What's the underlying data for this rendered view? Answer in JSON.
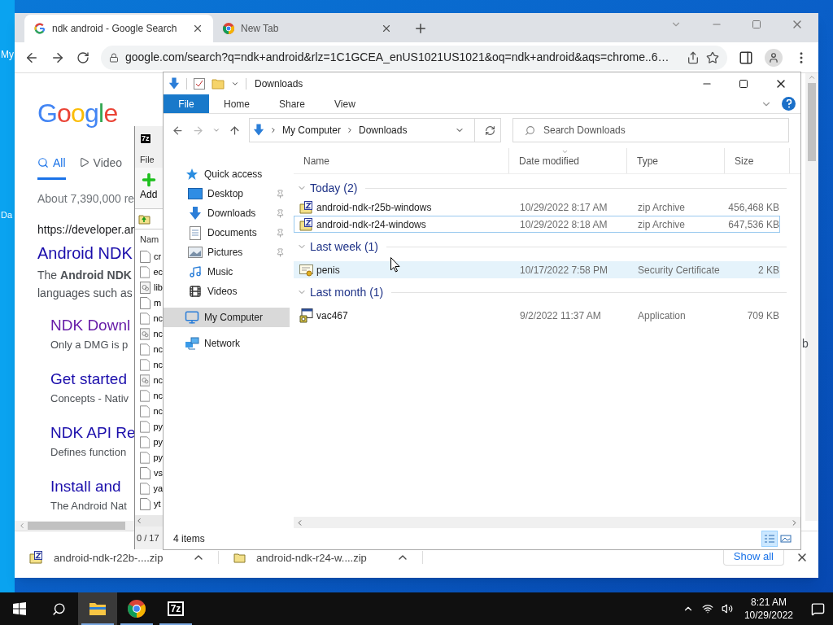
{
  "desktop": {
    "icons": [
      {
        "label": "My"
      },
      {
        "label": "Da"
      }
    ]
  },
  "chrome": {
    "tabs": [
      {
        "title": "ndk android - Google Search",
        "kind": "google",
        "selected": true
      },
      {
        "title": "New Tab",
        "kind": "chrome",
        "selected": false
      }
    ],
    "url": "google.com/search?q=ndk+android&rlz=1C1GCEA_enUS1021US1021&oq=ndk+android&aqs=chrome..6…",
    "page": {
      "logo": "Google",
      "tabs": [
        {
          "label": "All",
          "kind": "search",
          "selected": true
        },
        {
          "label": "Video",
          "kind": "video",
          "selected": false
        }
      ],
      "stats": "About 7,390,000 re",
      "cite": "https://developer.ar",
      "result_title": "Android NDK",
      "snippet": [
        "The **Android NDK**",
        "languages such as"
      ],
      "sublinks": [
        {
          "title": "NDK Downl",
          "snippet": "Only a DMG is p",
          "visited": true
        },
        {
          "title": "Get started",
          "snippet": "Concepts - Nativ",
          "visited": false
        },
        {
          "title": "NDK API Re",
          "snippet": "Defines function",
          "visited": false
        },
        {
          "title": "Install and",
          "snippet": "The Android Nat",
          "visited": false
        }
      ],
      "edge_text": "b"
    },
    "downloads": [
      {
        "name": "android-ndk-r22b-....zip",
        "kind": "zip"
      },
      {
        "name": "android-ndk-r24-w....zip",
        "kind": "partial"
      }
    ],
    "show_all": "Show all"
  },
  "sevenzip": {
    "icon": "7z",
    "menu": "File",
    "tool": "Add",
    "header": "Nam",
    "rows": [
      {
        "name": "cr",
        "kind": "file"
      },
      {
        "name": "ec",
        "kind": "file"
      },
      {
        "name": "lib",
        "kind": "gear"
      },
      {
        "name": "m",
        "kind": "file"
      },
      {
        "name": "nc",
        "kind": "file"
      },
      {
        "name": "nc",
        "kind": "gear"
      },
      {
        "name": "nc",
        "kind": "file"
      },
      {
        "name": "nc",
        "kind": "file"
      },
      {
        "name": "nc",
        "kind": "gear"
      },
      {
        "name": "nc",
        "kind": "file"
      },
      {
        "name": "nc",
        "kind": "file"
      },
      {
        "name": "py",
        "kind": "file"
      },
      {
        "name": "py",
        "kind": "file"
      },
      {
        "name": "py",
        "kind": "file"
      },
      {
        "name": "vs",
        "kind": "file"
      },
      {
        "name": "ya",
        "kind": "file"
      },
      {
        "name": "yt",
        "kind": "file"
      }
    ],
    "status": "0 / 17"
  },
  "explorer": {
    "title": "Downloads",
    "ribbon_tabs": [
      {
        "label": "File",
        "selected": true
      },
      {
        "label": "Home",
        "selected": false
      },
      {
        "label": "Share",
        "selected": false
      },
      {
        "label": "View",
        "selected": false
      }
    ],
    "breadcrumb": [
      "My Computer",
      "Downloads"
    ],
    "search_placeholder": "Search Downloads",
    "nav": [
      {
        "label": "Quick access",
        "kind": "star",
        "pinned": false,
        "selected": false
      },
      {
        "label": "Desktop",
        "kind": "desktop",
        "pinned": true,
        "selected": false
      },
      {
        "label": "Downloads",
        "kind": "download",
        "pinned": true,
        "selected": false
      },
      {
        "label": "Documents",
        "kind": "document",
        "pinned": true,
        "selected": false
      },
      {
        "label": "Pictures",
        "kind": "picture",
        "pinned": true,
        "selected": false
      },
      {
        "label": "Music",
        "kind": "music",
        "pinned": false,
        "selected": false
      },
      {
        "label": "Videos",
        "kind": "video",
        "pinned": false,
        "selected": false
      },
      {
        "label": "My Computer",
        "kind": "computer",
        "pinned": false,
        "selected": true
      },
      {
        "label": "Network",
        "kind": "network",
        "pinned": false,
        "selected": false
      }
    ],
    "columns": [
      "Name",
      "Date modified",
      "Type",
      "Size"
    ],
    "groups": [
      {
        "title": "Today (2)",
        "expanded": true,
        "rows": [
          {
            "name": "android-ndk-r25b-windows",
            "date": "10/29/2022 8:17 AM",
            "type": "zip Archive",
            "size": "456,468 KB",
            "kind": "zip",
            "focused": false,
            "hot": false
          },
          {
            "name": "android-ndk-r24-windows",
            "date": "10/29/2022 8:18 AM",
            "type": "zip Archive",
            "size": "647,536 KB",
            "kind": "zip",
            "focused": true,
            "hot": false
          }
        ]
      },
      {
        "title": "Last week (1)",
        "expanded": true,
        "rows": [
          {
            "name": "penis",
            "date": "10/17/2022 7:58 PM",
            "type": "Security Certificate",
            "size": "2 KB",
            "kind": "cert",
            "focused": false,
            "hot": true
          }
        ]
      },
      {
        "title": "Last month (1)",
        "expanded": true,
        "rows": [
          {
            "name": "vac467",
            "date": "9/2/2022 11:37 AM",
            "type": "Application",
            "size": "709 KB",
            "kind": "app",
            "focused": false,
            "hot": false
          }
        ]
      }
    ],
    "status": "4 items",
    "views": [
      {
        "kind": "details",
        "selected": true
      },
      {
        "kind": "large",
        "selected": false
      }
    ]
  },
  "taskbar": [
    {
      "kind": "start",
      "active": false
    },
    {
      "kind": "search",
      "active": false
    },
    {
      "kind": "explorer",
      "active": true
    },
    {
      "kind": "chrome",
      "active": false
    },
    {
      "kind": "sevenzip",
      "label": "7z",
      "active": false
    }
  ],
  "clock": {
    "time": "8:21 AM",
    "date": "10/29/2022"
  }
}
